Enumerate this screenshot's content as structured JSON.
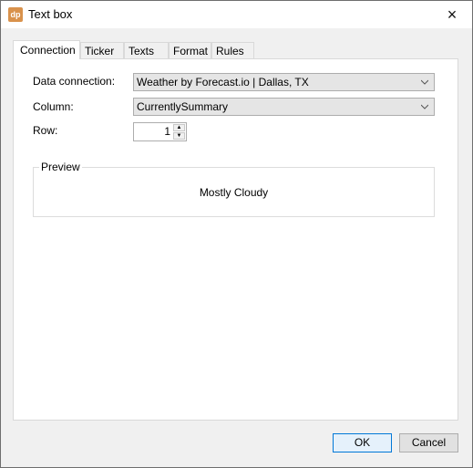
{
  "window": {
    "title": "Text box",
    "app_icon_text": "dp",
    "close_icon": "×"
  },
  "tabs": [
    {
      "label": "Connection",
      "active": true
    },
    {
      "label": "Ticker",
      "active": false
    },
    {
      "label": "Texts",
      "active": false
    },
    {
      "label": "Format",
      "active": false
    },
    {
      "label": "Rules",
      "active": false
    }
  ],
  "form": {
    "data_connection": {
      "label": "Data connection:",
      "value": "Weather by Forecast.io | Dallas, TX"
    },
    "column": {
      "label": "Column:",
      "value": "CurrentlySummary"
    },
    "row": {
      "label": "Row:",
      "value": "1",
      "up_icon": "▲",
      "down_icon": "▼"
    }
  },
  "preview": {
    "label": "Preview",
    "text": "Mostly Cloudy"
  },
  "buttons": {
    "ok": "OK",
    "cancel": "Cancel"
  }
}
